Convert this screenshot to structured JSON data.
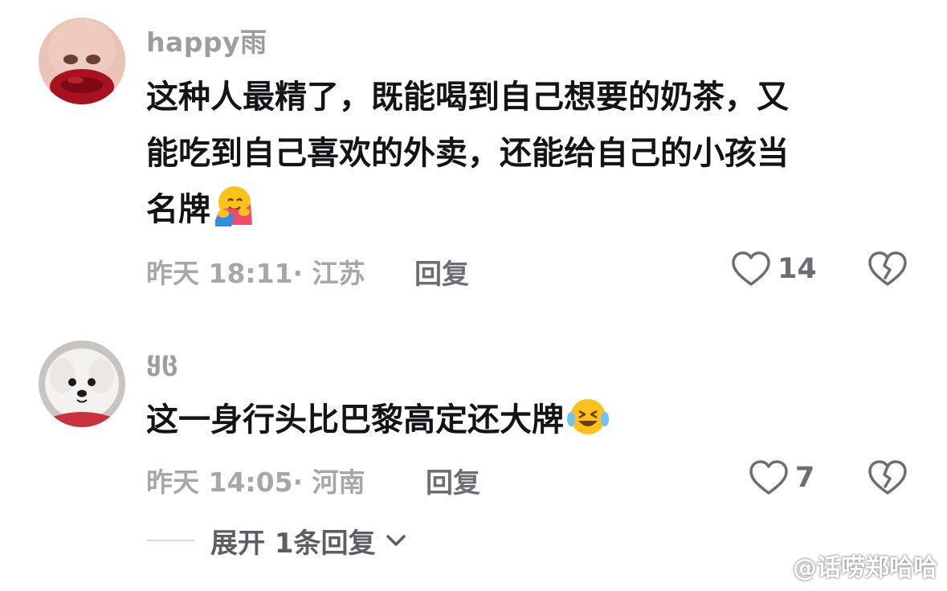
{
  "comments": [
    {
      "username": "happy雨",
      "lines": [
        "这种人最精了，既能喝到自己想要的奶茶，又",
        "能吃到自己喜欢的外卖，还能给自己的小孩当",
        "名牌"
      ],
      "emoji": "hugging-face-emoji",
      "meta": "昨天 18:11· 江苏",
      "reply_label": "回复",
      "like_count": "14"
    },
    {
      "username": "ყც",
      "lines": [
        "这一身行头比巴黎高定还大牌"
      ],
      "emoji": "crying-laughing-face-emoji",
      "meta": "昨天 14:05· 河南",
      "reply_label": "回复",
      "like_count": "7"
    }
  ],
  "expand_replies": {
    "label": "展开 1条回复"
  },
  "watermark": {
    "text": "@话唠郑哈哈"
  },
  "icons": {
    "like": "heart-outline-icon",
    "dislike": "broken-heart-icon",
    "expand": "chevron-down-icon",
    "watermark_logo": "weibo-logo-icon"
  },
  "colors": {
    "text": "#141418",
    "meta": "#a6a6ad",
    "icon": "#6d6d74"
  }
}
